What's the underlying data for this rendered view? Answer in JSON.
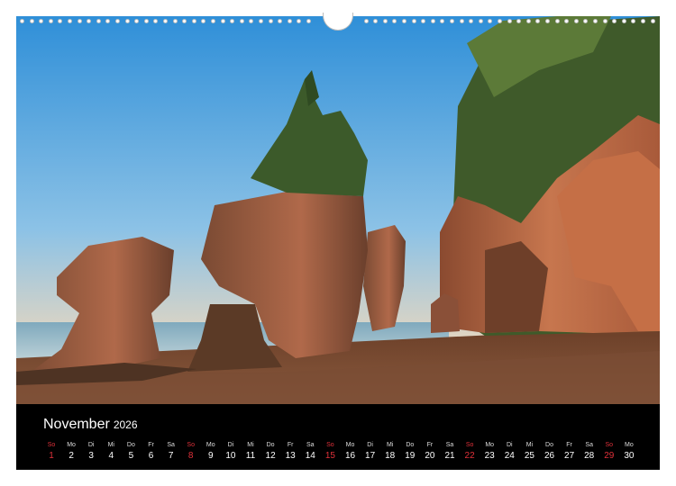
{
  "calendar": {
    "month": "November",
    "year": "2026",
    "accent_sunday_color": "#e0313a",
    "days": [
      {
        "abbr": "So",
        "num": "1",
        "sunday": true
      },
      {
        "abbr": "Mo",
        "num": "2",
        "sunday": false
      },
      {
        "abbr": "Di",
        "num": "3",
        "sunday": false
      },
      {
        "abbr": "Mi",
        "num": "4",
        "sunday": false
      },
      {
        "abbr": "Do",
        "num": "5",
        "sunday": false
      },
      {
        "abbr": "Fr",
        "num": "6",
        "sunday": false
      },
      {
        "abbr": "Sa",
        "num": "7",
        "sunday": false
      },
      {
        "abbr": "So",
        "num": "8",
        "sunday": true
      },
      {
        "abbr": "Mo",
        "num": "9",
        "sunday": false
      },
      {
        "abbr": "Di",
        "num": "10",
        "sunday": false
      },
      {
        "abbr": "Mi",
        "num": "11",
        "sunday": false
      },
      {
        "abbr": "Do",
        "num": "12",
        "sunday": false
      },
      {
        "abbr": "Fr",
        "num": "13",
        "sunday": false
      },
      {
        "abbr": "Sa",
        "num": "14",
        "sunday": false
      },
      {
        "abbr": "So",
        "num": "15",
        "sunday": true
      },
      {
        "abbr": "Mo",
        "num": "16",
        "sunday": false
      },
      {
        "abbr": "Di",
        "num": "17",
        "sunday": false
      },
      {
        "abbr": "Mi",
        "num": "18",
        "sunday": false
      },
      {
        "abbr": "Do",
        "num": "19",
        "sunday": false
      },
      {
        "abbr": "Fr",
        "num": "20",
        "sunday": false
      },
      {
        "abbr": "Sa",
        "num": "21",
        "sunday": false
      },
      {
        "abbr": "So",
        "num": "22",
        "sunday": true
      },
      {
        "abbr": "Mo",
        "num": "23",
        "sunday": false
      },
      {
        "abbr": "Di",
        "num": "24",
        "sunday": false
      },
      {
        "abbr": "Mi",
        "num": "25",
        "sunday": false
      },
      {
        "abbr": "Do",
        "num": "26",
        "sunday": false
      },
      {
        "abbr": "Fr",
        "num": "27",
        "sunday": false
      },
      {
        "abbr": "Sa",
        "num": "28",
        "sunday": false
      },
      {
        "abbr": "So",
        "num": "29",
        "sunday": true
      },
      {
        "abbr": "Mo",
        "num": "30",
        "sunday": false
      }
    ]
  },
  "photo": {
    "subject": "sea-stack rock formations with trees on a beach at sunrise"
  }
}
